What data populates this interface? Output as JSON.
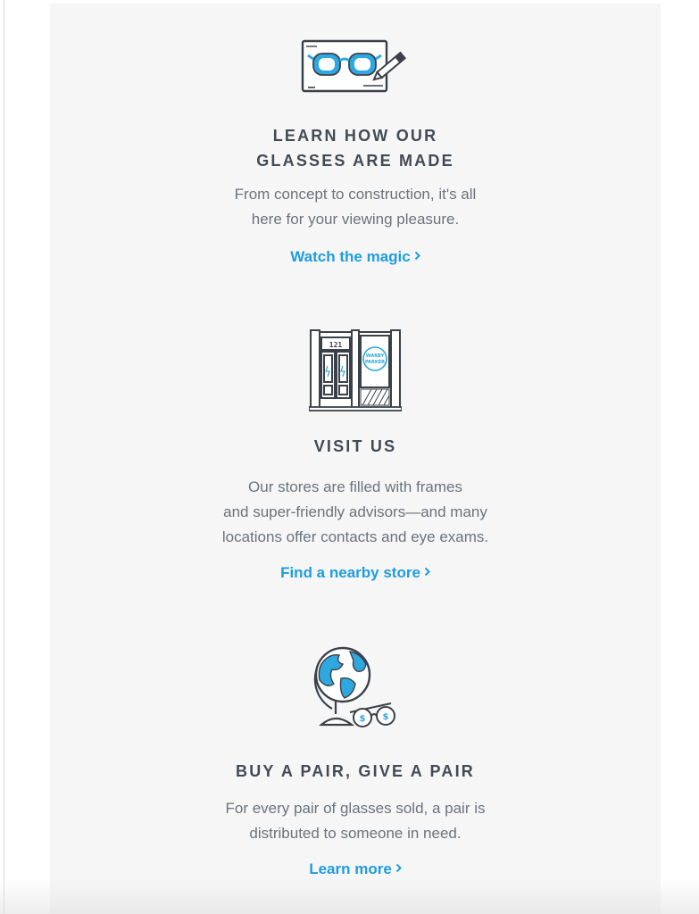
{
  "sections": [
    {
      "icon": "glasses-sketch-icon",
      "heading_line1": "LEARN HOW OUR",
      "heading_line2": "GLASSES ARE MADE",
      "body_line1": "From concept to construction, it's all",
      "body_line2": "here for your viewing pleasure.",
      "cta": "Watch the magic"
    },
    {
      "icon": "storefront-icon",
      "storefront_number": "121",
      "storefront_sign_line1": "WARBY",
      "storefront_sign_line2": "PARKER",
      "heading_line1": "VISIT US",
      "body_line1": "Our stores are filled with frames",
      "body_line2": "and super-friendly advisors—and many",
      "body_line3": "locations offer contacts and eye exams.",
      "cta": "Find a nearby store"
    },
    {
      "icon": "globe-glasses-icon",
      "heading_line1": "BUY A PAIR, GIVE A PAIR",
      "body_line1": "For every pair of glasses sold, a pair is",
      "body_line2": "distributed to someone in need.",
      "cta": "Learn more"
    }
  ],
  "colors": {
    "panel_bg": "#f6f6f7",
    "heading": "#414b56",
    "body": "#6b737c",
    "link": "#1f9ce0",
    "accent_blue": "#2fa7df"
  }
}
